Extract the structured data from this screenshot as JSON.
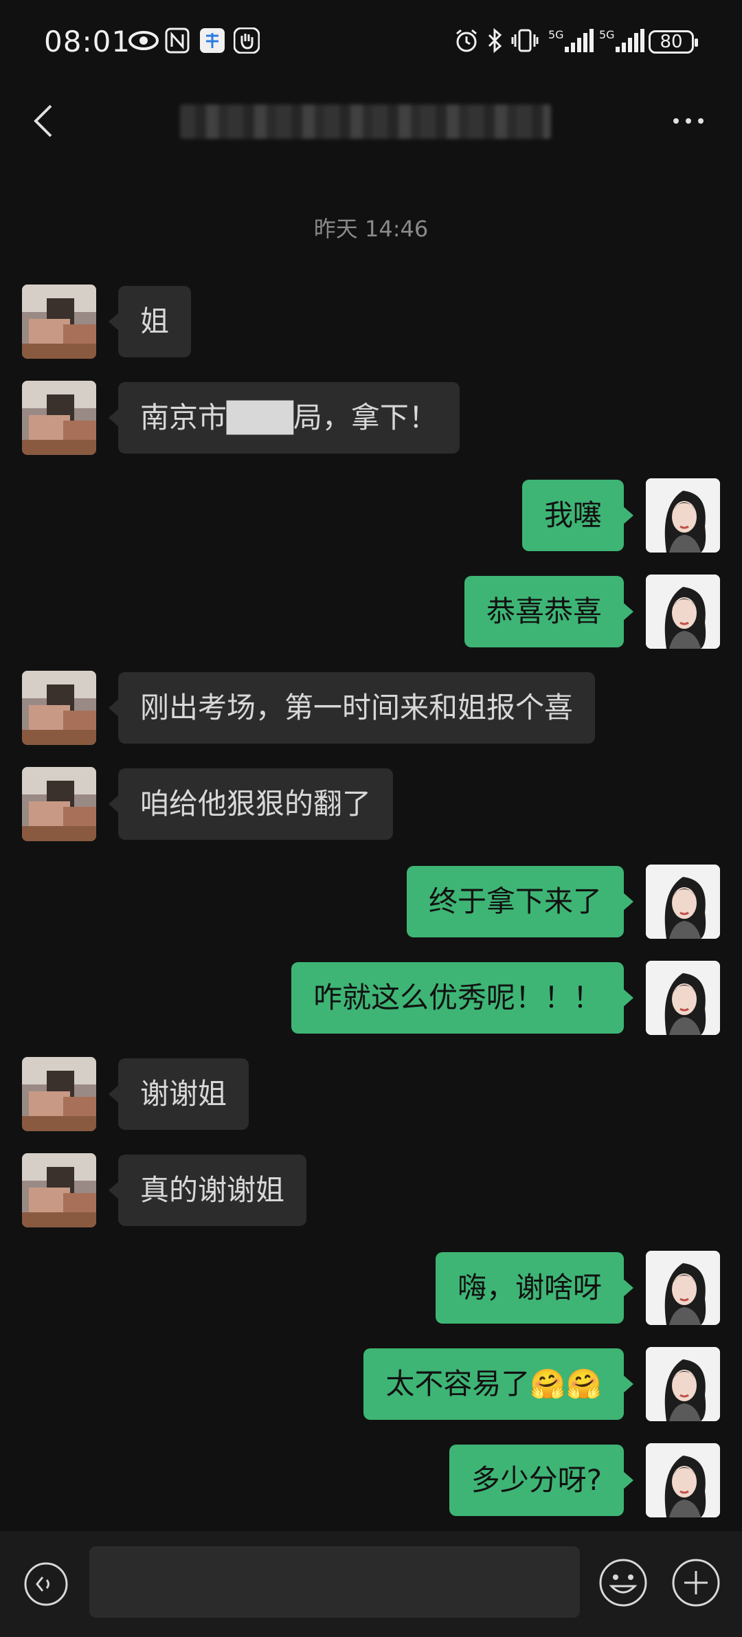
{
  "status_bar": {
    "time": "08:01",
    "icons": [
      "eye-icon",
      "nfc-icon",
      "alipay-icon",
      "hand-icon"
    ],
    "right_icons": [
      "alarm-icon",
      "bluetooth-icon",
      "vibrate-icon",
      "signal-5g-icon",
      "signal-5g-icon"
    ],
    "signal_label_1": "5G",
    "signal_label_2": "5G",
    "battery": "80"
  },
  "header": {
    "back_icon": "chevron-left-icon",
    "more_icon": "more-icon"
  },
  "chat": {
    "timestamp": "昨天 14:46",
    "messages": [
      {
        "side": "in",
        "text": "姐"
      },
      {
        "side": "in",
        "text": "南京市███局，拿下！"
      },
      {
        "side": "out",
        "text": "我噻"
      },
      {
        "side": "out",
        "text": "恭喜恭喜"
      },
      {
        "side": "in",
        "text": "刚出考场，第一时间来和姐报个喜"
      },
      {
        "side": "in",
        "text": "咱给他狠狠的翻了"
      },
      {
        "side": "out",
        "text": "终于拿下来了"
      },
      {
        "side": "out",
        "text": "咋就这么优秀呢！！！"
      },
      {
        "side": "in",
        "text": "谢谢姐"
      },
      {
        "side": "in",
        "text": "真的谢谢姐"
      },
      {
        "side": "out",
        "text": "嗨，谢啥呀"
      },
      {
        "side": "out",
        "text": "太不容易了🤗🤗"
      },
      {
        "side": "out",
        "text": "多少分呀?"
      }
    ]
  },
  "input_bar": {
    "voice_icon": "voice-icon",
    "emoji_icon": "emoji-icon",
    "plus_icon": "plus-icon"
  },
  "colors": {
    "background": "#111111",
    "incoming_bubble": "#2c2c2c",
    "outgoing_bubble": "#3eb575"
  }
}
